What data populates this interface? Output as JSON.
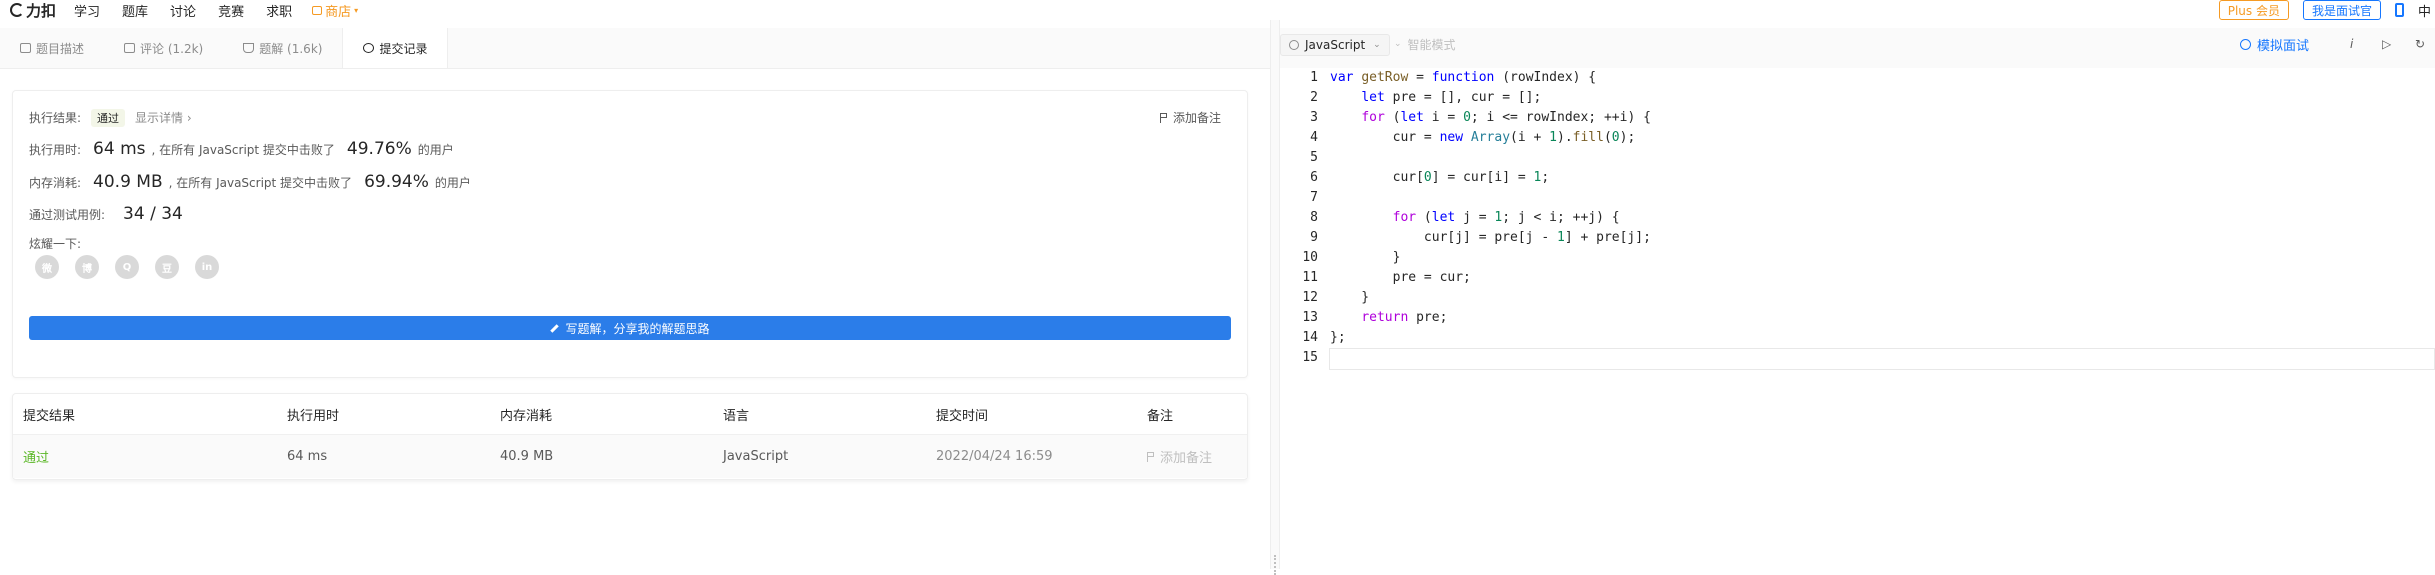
{
  "nav": {
    "logo": "力扣",
    "links": [
      "学习",
      "题库",
      "讨论",
      "竞赛",
      "求职"
    ],
    "shop": "商店",
    "plus": "Plus 会员",
    "interviewer": "我是面试官",
    "lang": "中"
  },
  "tabs": [
    {
      "label": "题目描述",
      "icon": "doc-icon"
    },
    {
      "label": "评论 (1.2k)",
      "icon": "comment-icon"
    },
    {
      "label": "题解 (1.6k)",
      "icon": "flask-icon"
    },
    {
      "label": "提交记录",
      "icon": "clock-icon"
    }
  ],
  "result": {
    "label": "执行结果:",
    "status": "通过",
    "detail_link": "显示详情 ›",
    "add_note": "添加备注",
    "time_label": "执行用时:",
    "time_value": "64 ms",
    "time_desc": ", 在所有 JavaScript 提交中击败了",
    "time_pct": "49.76%",
    "users": "的用户",
    "mem_label": "内存消耗:",
    "mem_value": "40.9 MB",
    "mem_desc": ", 在所有 JavaScript 提交中击败了",
    "mem_pct": "69.94%",
    "cases_label": "通过测试用例:",
    "cases_value": "34 / 34",
    "share_label": "炫耀一下:",
    "share_icons": [
      "wechat-icon",
      "weibo-icon",
      "qq-icon",
      "douban-icon",
      "linkedin-icon"
    ],
    "share_glyphs": [
      "微",
      "博",
      "Q",
      "豆",
      "in"
    ],
    "write_btn": "写题解，分享我的解题思路"
  },
  "table": {
    "headers": [
      "提交结果",
      "执行用时",
      "内存消耗",
      "语言",
      "提交时间",
      "备注"
    ],
    "row": {
      "status": "通过",
      "time": "64 ms",
      "memory": "40.9 MB",
      "language": "JavaScript",
      "submitted": "2022/04/24 16:59",
      "note": "添加备注"
    }
  },
  "editor": {
    "language": "JavaScript",
    "smart_mode": "智能模式",
    "mock_interview": "模拟面试",
    "line_numbers": [
      "1",
      "2",
      "3",
      "4",
      "5",
      "6",
      "7",
      "8",
      "9",
      "10",
      "11",
      "12",
      "13",
      "14",
      "15"
    ]
  },
  "colors": {
    "accent": "#2b7de9",
    "pass": "#5ab726",
    "shop": "#f59a23",
    "link_blue": "#1677ff"
  }
}
